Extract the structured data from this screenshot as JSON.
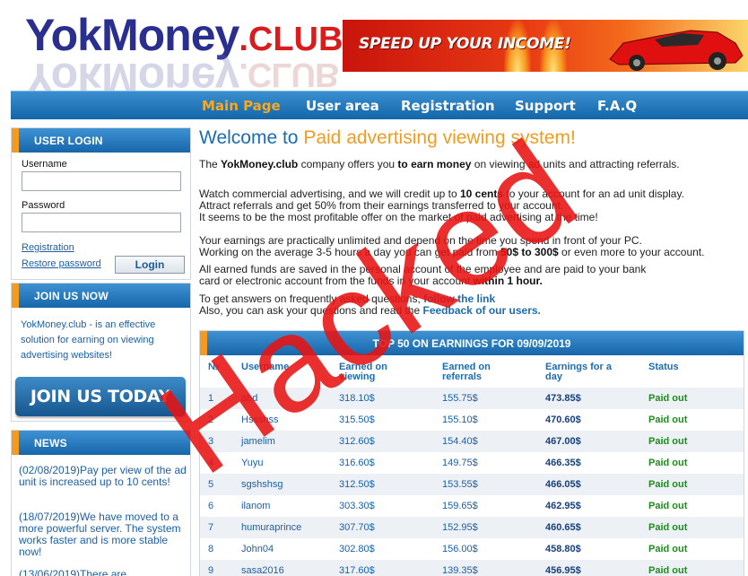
{
  "header": {
    "logo_main": "YokMoney",
    "logo_suffix": ".CLUB",
    "banner_text": "SPEED UP YOUR INCOME!"
  },
  "nav": {
    "items": [
      "Main Page",
      "User area",
      "Registration",
      "Support",
      "F.A.Q"
    ],
    "active": "Main Page"
  },
  "sidebar": {
    "login": {
      "title": "USER LOGIN",
      "username_label": "Username",
      "username_value": "",
      "password_label": "Password",
      "password_value": "",
      "registration_link": "Registration",
      "restore_link": "Restore password",
      "login_button": "Login"
    },
    "join": {
      "title": "JOIN US NOW",
      "text": "YokMoney.club - is an effective solution for earning on viewing advertising websites!",
      "button": "JOIN US TODAY"
    },
    "news": {
      "title": "NEWS",
      "items": [
        "(02/08/2019)Pay per view of the ad unit is increased up to 10 cents!",
        "(18/07/2019)We have moved to a more powerful server. The system works faster and is more stable now!",
        "(13/06/2019)There are"
      ]
    }
  },
  "main": {
    "welcome_prefix": "Welcome to ",
    "welcome_highlight": "Paid advertising viewing system!",
    "intro": {
      "p1": "The ",
      "brand": "YokMoney.club",
      "p2": " company offers you ",
      "earn": "to earn money",
      "p3": " on viewing ad units and attracting referrals."
    },
    "para2": {
      "l1a": "Watch commercial advertising, and we will credit up to ",
      "l1b": "10 cents",
      "l1c": " to your account for an ad unit display.",
      "l2": "Attract referrals and get 50% from their earnings transferred to your account.",
      "l3": "It seems to be the most profitable offer on the market of paid advertising at the time!"
    },
    "para3": {
      "l1": "Your earnings are practically unlimited and depend on the time you spend in front of your PC.",
      "l2a": "Working on the average 3-5 hours a day you can get paid from ",
      "l2b": "50$ to 300$",
      "l2c": " or even more to your account."
    },
    "para4": {
      "l1": "All earned funds are saved in the personal account of the employee and are paid to your bank",
      "l2a": "card or electronic account from the funds in your account ",
      "l2b": "within 1 hour."
    },
    "para5": {
      "l1a": "To get answers on frequently asked questions, ",
      "l1link": "follow the link",
      "l2a": "Also, you can ask your questions and read the ",
      "l2link": "Feedback of our users."
    },
    "overlay_text": "Hacked"
  },
  "top_table": {
    "title": "TOP 50 ON EARNINGS FOR 09/09/2019",
    "columns": [
      "№",
      "Username",
      "Earned on viewing",
      "Earned on referrals",
      "Earnings for a day",
      "Status"
    ],
    "rows": [
      [
        "1",
        "abd",
        "318.10$",
        "155.75$",
        "473.85$",
        "Paid out"
      ],
      [
        "2",
        "Hssshss",
        "315.50$",
        "155.10$",
        "470.60$",
        "Paid out"
      ],
      [
        "3",
        "jamelim",
        "312.60$",
        "154.40$",
        "467.00$",
        "Paid out"
      ],
      [
        "4",
        "Yuyu",
        "316.60$",
        "149.75$",
        "466.35$",
        "Paid out"
      ],
      [
        "5",
        "sgshshsg",
        "312.50$",
        "153.55$",
        "466.05$",
        "Paid out"
      ],
      [
        "6",
        "ilanom",
        "303.30$",
        "159.65$",
        "462.95$",
        "Paid out"
      ],
      [
        "7",
        "humuraprince",
        "307.70$",
        "152.95$",
        "460.65$",
        "Paid out"
      ],
      [
        "8",
        "John04",
        "302.80$",
        "156.00$",
        "458.80$",
        "Paid out"
      ],
      [
        "9",
        "sasa2016",
        "317.60$",
        "139.35$",
        "456.95$",
        "Paid out"
      ]
    ]
  },
  "colors": {
    "nav_blue": "#1a6cb4",
    "accent_orange": "#f39a1f",
    "logo_navy": "#2a2e8f",
    "logo_red": "#d91d1d",
    "status_green": "#1f8a1f",
    "overlay_red": "#e81212"
  }
}
